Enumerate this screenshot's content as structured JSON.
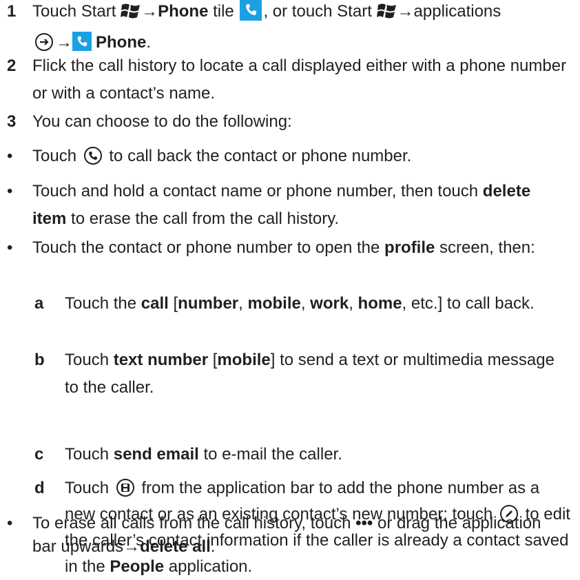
{
  "step1": {
    "num": "1",
    "t1": "Touch Start",
    "t2": "→",
    "t3": "Phone",
    "t4": "tile",
    "t5": ", or touch Start",
    "t6": "→applications",
    "t7": "→",
    "t8": "Phone",
    "t9": "."
  },
  "step2": {
    "num": "2",
    "text": "Flick the call history to locate a call displayed either with a phone number or with a contact’s name."
  },
  "step3": {
    "num": "3",
    "text": "You can choose to do the following:"
  },
  "bullet1": {
    "dot": "•",
    "t1": "Touch",
    "t2": "to call back the contact or phone number."
  },
  "bullet2": {
    "dot": "•",
    "t1": "Touch and hold a contact name or phone number, then touch",
    "t2": "delete item",
    "t3": "to erase the call from the call history."
  },
  "bullet3": {
    "dot": "•",
    "t1": "Touch the contact or phone number to open the",
    "t2": "profile",
    "t3": "screen, then:"
  },
  "subA": {
    "letter": "a",
    "t1": "Touch the",
    "t2": "call",
    "t3": "[",
    "t4": "number",
    "t5": ",",
    "t6": "mobile",
    "t7": ",",
    "t8": "work",
    "t9": ",",
    "t10": "home",
    "t11": ", etc.] to call back."
  },
  "subB": {
    "letter": "b",
    "t1": "Touch",
    "t2": "text number",
    "t3": "[",
    "t4": "mobile",
    "t5": "] to send a text or multimedia message to the caller."
  },
  "subC": {
    "letter": "c",
    "t1": "Touch",
    "t2": "send email",
    "t3": "to e-mail the caller."
  },
  "subD": {
    "letter": "d",
    "t1": "Touch",
    "t2": "from the application bar to add the phone number as a new contact or as an existing contact’s new number;",
    "t3": "touch",
    "t4": "to edit the caller’s contact information if the caller is already a contact saved in the",
    "t5": "People",
    "t6": "application."
  },
  "bullet4": {
    "dot": "•",
    "t1": "To erase all calls from the call history, touch",
    "t2": "•••",
    "t3": "or drag the application bar upwards",
    "t4": "→",
    "t5": "delete all",
    "t6": "."
  },
  "colors": {
    "text": "#231f20",
    "tile": "#1ba1e2"
  },
  "icons": [
    "windows-start-icon",
    "phone-tile-icon",
    "applications-arrow-icon",
    "call-back-icon",
    "save-contact-icon",
    "edit-icon"
  ]
}
